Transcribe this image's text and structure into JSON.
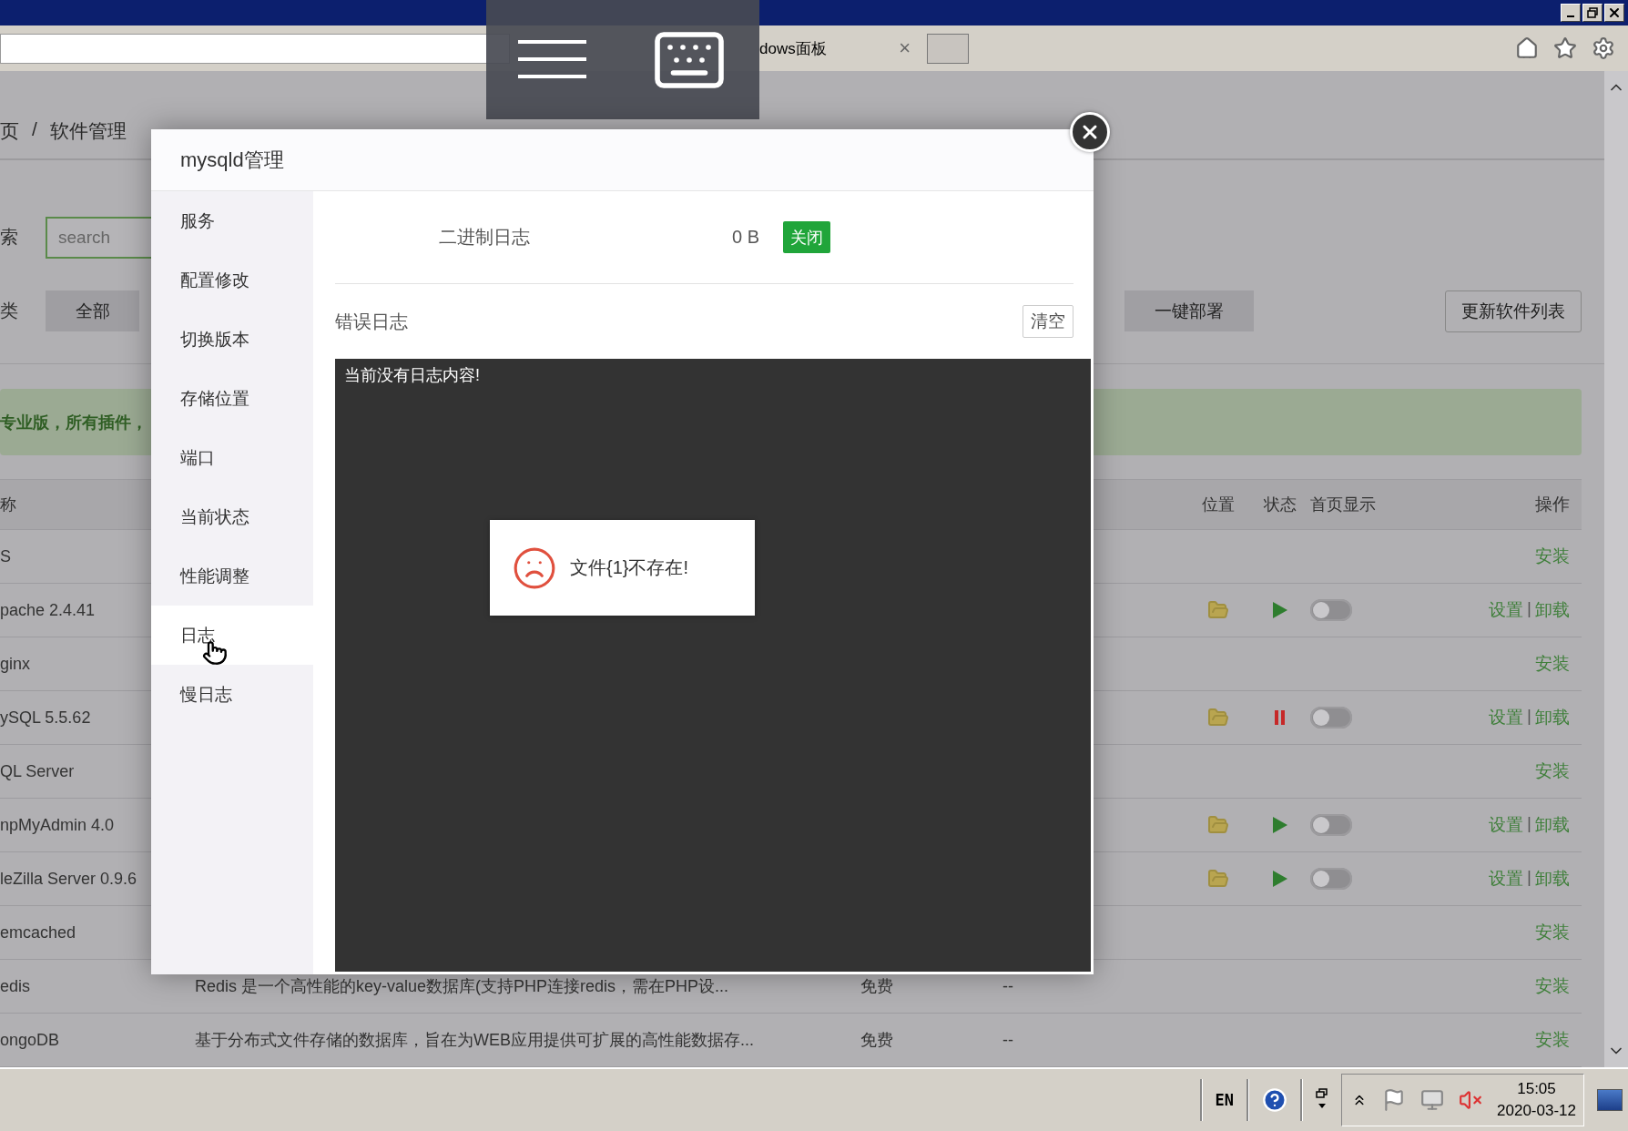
{
  "browser": {
    "tab": {
      "title": "dows面板",
      "close": "×"
    }
  },
  "page": {
    "breadcrumb": [
      "页",
      "软件管理"
    ],
    "breadcrumb_separator": "/",
    "search": {
      "label": "索",
      "placeholder": "search"
    },
    "category": {
      "label": "类",
      "tabs": [
        {
          "label": "全部",
          "selected": true
        }
      ]
    },
    "deploy_button": "一键部署",
    "refresh_button": "更新软件列表",
    "banner": "专业版，所有插件，",
    "table": {
      "columns": {
        "name": "称",
        "position": "位置",
        "status": "状态",
        "home_display": "首页显示",
        "actions": "操作"
      },
      "action_separator": "|",
      "rows": [
        {
          "kind": "available",
          "name": "S",
          "actions": [
            "安装"
          ]
        },
        {
          "kind": "installed",
          "name": "pache 2.4.41",
          "running": true,
          "home_on": false,
          "actions": [
            "设置",
            "卸载"
          ]
        },
        {
          "kind": "available",
          "name": "ginx",
          "actions": [
            "安装"
          ]
        },
        {
          "kind": "installed",
          "name": "ySQL 5.5.62",
          "running": false,
          "home_on": false,
          "actions": [
            "设置",
            "卸载"
          ]
        },
        {
          "kind": "available",
          "name": "QL Server",
          "actions": [
            "安装"
          ]
        },
        {
          "kind": "installed",
          "name": "npMyAdmin 4.0",
          "running": true,
          "home_on": false,
          "actions": [
            "设置",
            "卸载"
          ]
        },
        {
          "kind": "installed",
          "name": "leZilla Server 0.9.6",
          "running": true,
          "home_on": false,
          "actions": [
            "设置",
            "卸载"
          ]
        },
        {
          "kind": "available",
          "name": "emcached",
          "actions": [
            "安装"
          ]
        },
        {
          "kind": "available",
          "name": "edis",
          "description": "Redis 是一个高性能的key-value数据库(支持PHP连接redis，需在PHP设...",
          "price": "免费",
          "expiry": "--",
          "actions": [
            "安装"
          ]
        },
        {
          "kind": "available",
          "name": "ongoDB",
          "description": "基于分布式文件存储的数据库，旨在为WEB应用提供可扩展的高性能数据存...",
          "price": "免费",
          "expiry": "--",
          "actions": [
            "安装"
          ]
        }
      ]
    }
  },
  "dialog": {
    "title": "mysqld管理",
    "menu": [
      {
        "label": "服务",
        "selected": false
      },
      {
        "label": "配置修改",
        "selected": false
      },
      {
        "label": "切换版本",
        "selected": false
      },
      {
        "label": "存储位置",
        "selected": false
      },
      {
        "label": "端口",
        "selected": false
      },
      {
        "label": "当前状态",
        "selected": false
      },
      {
        "label": "性能调整",
        "selected": false
      },
      {
        "label": "日志",
        "selected": true
      },
      {
        "label": "慢日志",
        "selected": false
      }
    ],
    "binary_log": {
      "label": "二进制日志",
      "size": "0 B",
      "button": "关闭"
    },
    "error_log": {
      "label": "错误日志",
      "button": "清空",
      "content": "当前没有日志内容!"
    }
  },
  "toast": {
    "message": "文件{1}不存在!"
  },
  "taskbar": {
    "language": "EN",
    "time": "15:05",
    "date": "2020-03-12"
  }
}
